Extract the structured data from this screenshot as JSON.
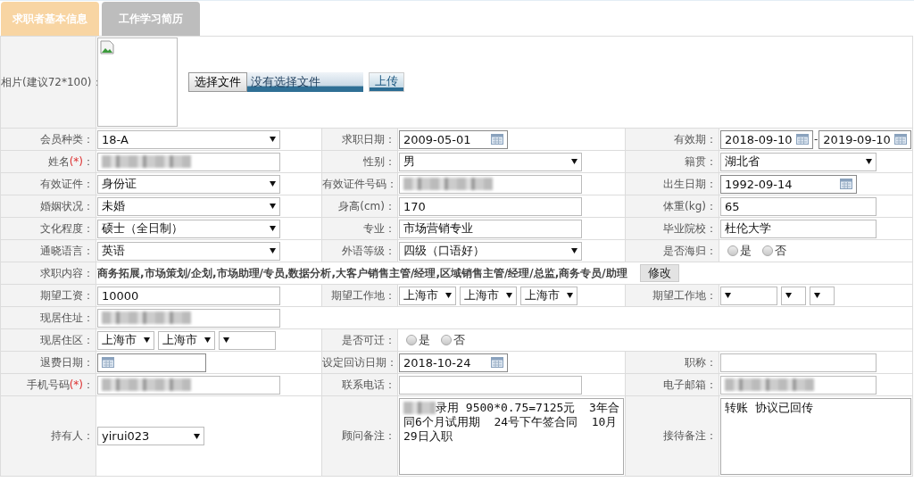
{
  "tabs": [
    {
      "label": "求职者基本信息",
      "selected": true
    },
    {
      "label": "工作学习简历",
      "selected": false
    }
  ],
  "rows": [
    {
      "cells": [
        {
          "label": "相片(建议72*100)：",
          "field": {
            "kind": "photo",
            "choose_button": "选择文件",
            "file_status": "没有选择文件",
            "upload_button": "上传"
          }
        }
      ]
    },
    {
      "cells": [
        {
          "label": "会员种类：",
          "field": {
            "kind": "select",
            "value": "18-A"
          }
        },
        {
          "label": "求职日期：",
          "field": {
            "kind": "date",
            "value": "2009-05-01"
          }
        },
        {
          "label": "有效期：",
          "field": {
            "kind": "daterange",
            "from": "2018-09-10",
            "separator": "-",
            "to": "2019-09-10"
          }
        }
      ]
    },
    {
      "cells": [
        {
          "label": "姓名",
          "required_mark": "(*)",
          "label_end": "：",
          "field": {
            "kind": "text",
            "redacted": true
          }
        },
        {
          "label": "性别：",
          "field": {
            "kind": "select",
            "value": "男"
          }
        },
        {
          "label": "籍贯：",
          "field": {
            "kind": "select",
            "value": "湖北省"
          }
        }
      ]
    },
    {
      "cells": [
        {
          "label": "有效证件：",
          "field": {
            "kind": "select",
            "value": "身份证"
          }
        },
        {
          "label": "有效证件号码：",
          "field": {
            "kind": "text",
            "redacted": true
          }
        },
        {
          "label": "出生日期：",
          "field": {
            "kind": "date",
            "value": "1992-09-14"
          }
        }
      ]
    },
    {
      "cells": [
        {
          "label": "婚姻状况：",
          "field": {
            "kind": "select",
            "value": "未婚"
          }
        },
        {
          "label": "身高(cm)：",
          "field": {
            "kind": "text",
            "value": "170"
          }
        },
        {
          "label": "体重(kg)：",
          "field": {
            "kind": "text",
            "value": "65"
          }
        }
      ]
    },
    {
      "cells": [
        {
          "label": "文化程度：",
          "field": {
            "kind": "select",
            "value": "硕士（全日制）"
          }
        },
        {
          "label": "专业：",
          "field": {
            "kind": "text",
            "value": "市场营销专业"
          }
        },
        {
          "label": "毕业院校：",
          "field": {
            "kind": "text",
            "value": "杜伦大学"
          }
        }
      ]
    },
    {
      "cells": [
        {
          "label": "通晓语言：",
          "field": {
            "kind": "select",
            "value": "英语"
          }
        },
        {
          "label": "外语等级：",
          "field": {
            "kind": "select",
            "value": "四级（口语好）"
          }
        },
        {
          "label": "是否海归：",
          "field": {
            "kind": "radio",
            "options": [
              {
                "label": "是",
                "selected": false
              },
              {
                "label": "否",
                "selected": false
              }
            ]
          }
        }
      ]
    },
    {
      "cells": [
        {
          "label": "求职内容：",
          "field": {
            "kind": "jobs",
            "text": "商务拓展,市场策划/企划,市场助理/专员,数据分析,大客户销售主管/经理,区域销售主管/经理/总监,商务专员/助理",
            "button": "修改"
          }
        }
      ]
    },
    {
      "cells": [
        {
          "label": "期望工资：",
          "field": {
            "kind": "text",
            "value": "10000"
          }
        },
        {
          "label": "期望工作地：",
          "field": {
            "kind": "selects",
            "selects": [
              {
                "value": "上海市"
              },
              {
                "value": "上海市"
              },
              {
                "value": "上海市"
              }
            ]
          }
        },
        {
          "label": "期望工作地：",
          "field": {
            "kind": "selects",
            "selects": [
              {
                "blank": true
              },
              {
                "blank": true
              },
              {
                "blank": true
              }
            ]
          }
        }
      ]
    },
    {
      "cells": [
        {
          "label": "现居住址：",
          "field": {
            "kind": "text",
            "redacted": true
          }
        }
      ]
    },
    {
      "cells": [
        {
          "label": "现居住区：",
          "field": {
            "kind": "selects",
            "selects": [
              {
                "value": "上海市"
              },
              {
                "value": "上海市"
              },
              {
                "blank": true
              }
            ]
          }
        },
        {
          "label": "是否可迁：",
          "field": {
            "kind": "radio",
            "options": [
              {
                "label": "是",
                "selected": false
              },
              {
                "label": "否",
                "selected": false
              }
            ]
          }
        }
      ]
    },
    {
      "cells": [
        {
          "label": "退费日期：",
          "field": {
            "kind": "date"
          }
        },
        {
          "label": "设定回访日期：",
          "field": {
            "kind": "date",
            "value": "2018-10-24"
          }
        },
        {
          "label": "职称：",
          "field": {
            "kind": "text"
          }
        }
      ]
    },
    {
      "cells": [
        {
          "label": "手机号码",
          "required_mark": "(*)",
          "label_end": "：",
          "field": {
            "kind": "text",
            "redacted": true
          }
        },
        {
          "label": "联系电话：",
          "field": {
            "kind": "text"
          }
        },
        {
          "label": "电子邮箱：",
          "field": {
            "kind": "text",
            "redacted": true
          }
        }
      ]
    },
    {
      "cells": [
        {
          "label": "持有人：",
          "field": {
            "kind": "select",
            "value": "yirui023"
          }
        },
        {
          "label": "顾问备注：",
          "field": {
            "kind": "textarea",
            "redacted_prefix": true,
            "value": "录用 9500*0.75=7125元  3年合同6个月试用期  24号下午签合同  10月29日入职"
          }
        },
        {
          "label": "接待备注：",
          "field": {
            "kind": "textarea",
            "value": "转账 协议已回传"
          }
        }
      ]
    }
  ]
}
